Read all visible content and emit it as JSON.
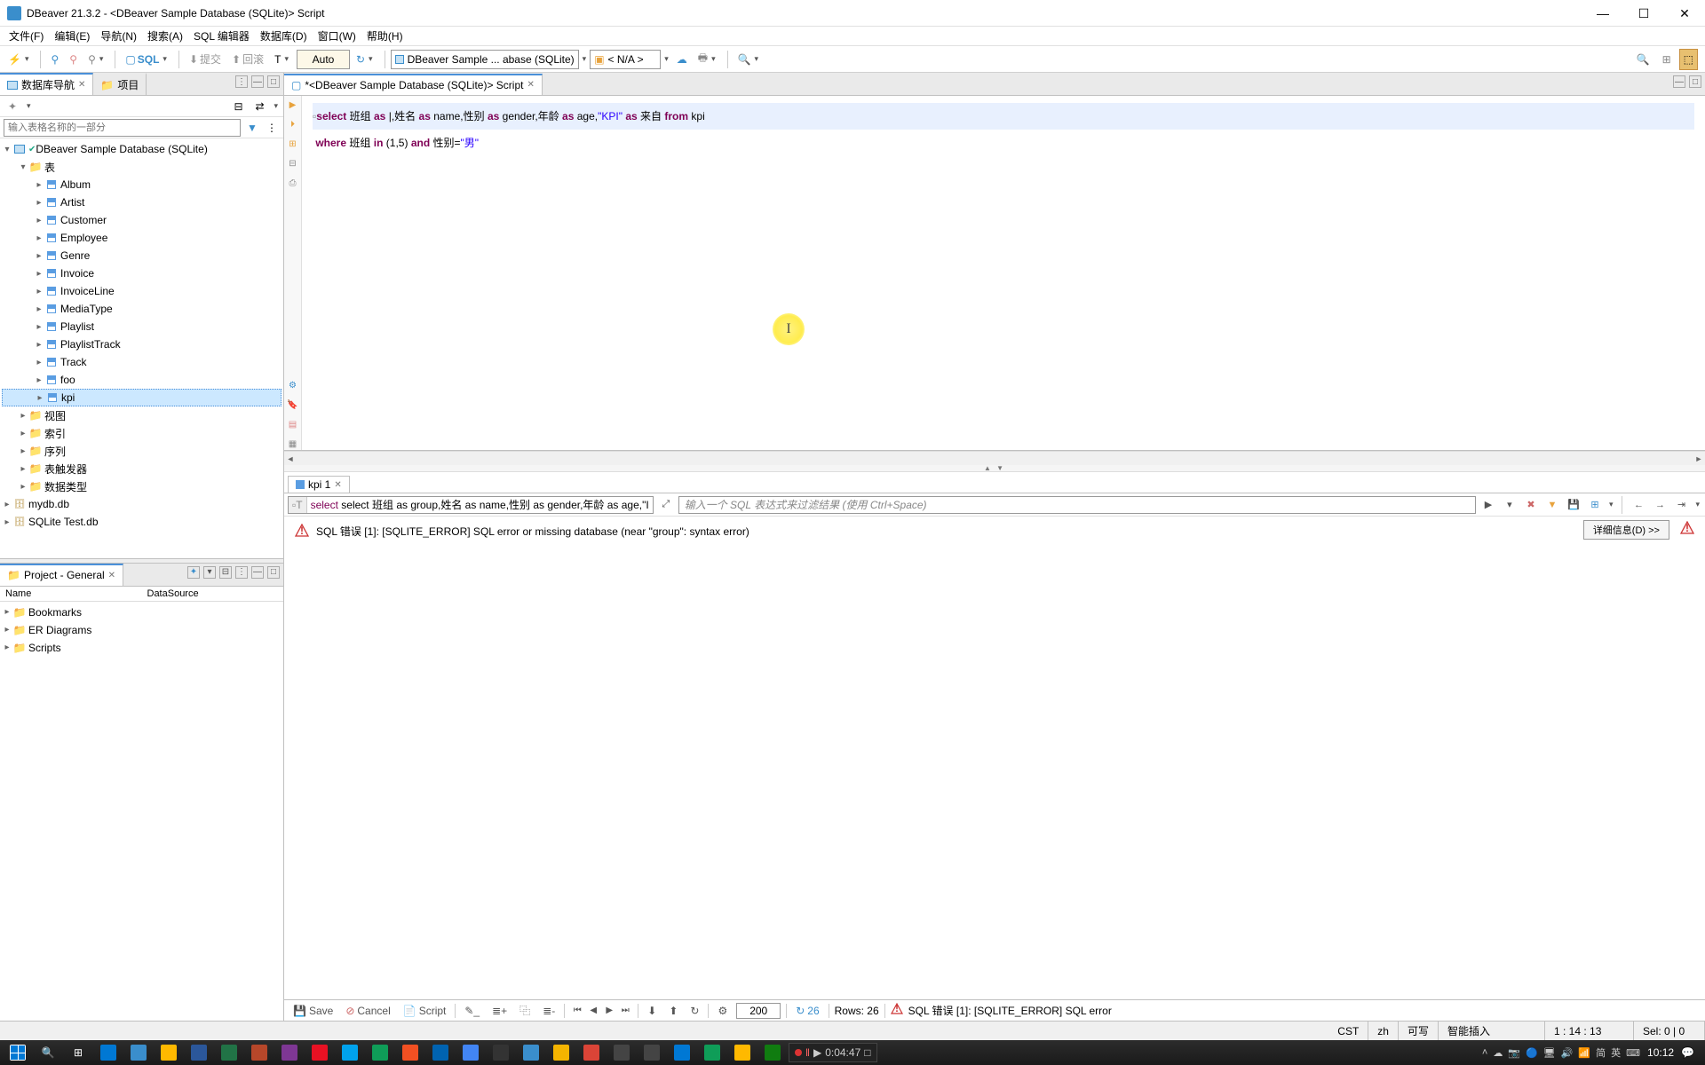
{
  "window": {
    "title": "DBeaver 21.3.2 - <DBeaver Sample Database (SQLite)> Script"
  },
  "menus": [
    "文件(F)",
    "编辑(E)",
    "导航(N)",
    "搜索(A)",
    "SQL 编辑器",
    "数据库(D)",
    "窗口(W)",
    "帮助(H)"
  ],
  "toolbar": {
    "sql_label": "SQL",
    "commit_label": "提交",
    "rollback_label": "回滚",
    "auto_label": "Auto",
    "conn1": "DBeaver Sample ... abase (SQLite)",
    "conn2": "< N/A >"
  },
  "nav": {
    "tab1": "数据库导航",
    "tab2": "项目",
    "filter_placeholder": "输入表格名称的一部分",
    "root": "DBeaver Sample Database (SQLite)",
    "tables_label": "表",
    "tables": [
      "Album",
      "Artist",
      "Customer",
      "Employee",
      "Genre",
      "Invoice",
      "InvoiceLine",
      "MediaType",
      "Playlist",
      "PlaylistTrack",
      "Track",
      "foo",
      "kpi"
    ],
    "folders": [
      "视图",
      "索引",
      "序列",
      "表触发器",
      "数据类型"
    ],
    "db1": "mydb.db",
    "db2": "SQLite Test.db"
  },
  "project": {
    "title": "Project - General",
    "col1": "Name",
    "col2": "DataSource",
    "items": [
      "Bookmarks",
      "ER Diagrams",
      "Scripts"
    ]
  },
  "editor": {
    "tab": "*<DBeaver Sample Database (SQLite)> Script",
    "sql_tokens": {
      "l1": {
        "select": "select",
        "f1": "班组",
        "as": "as",
        "cursor": "|",
        "f2": ",姓名",
        "name": "name",
        "f3": ",性别",
        "gender": "gender",
        "f4": ",年龄",
        "age": "age",
        "f5": ",",
        "kpi_str": "\"KPI\"",
        "from_field": "来自",
        "from": "from",
        "table": "kpi"
      },
      "l2": {
        "where": "where",
        "f1": "班组",
        "in": "in",
        "paren": "(",
        "n1": "1",
        "comma": ",",
        "n5": "5",
        "rparen": ")",
        "and": "and",
        "f2": "性别=",
        "str": "\"男\""
      }
    }
  },
  "results": {
    "tab": "kpi 1",
    "info_sql": "select 班组 as group,姓名 as name,性别 as gender,年龄 as age,\"I",
    "placeholder": "输入一个 SQL 表达式来过滤结果 (使用 Ctrl+Space)",
    "error": "SQL 错误 [1]: [SQLITE_ERROR] SQL error or missing database (near \"group\": syntax error)",
    "detail_btn": "详细信息(D) >>"
  },
  "bottom": {
    "save": "Save",
    "cancel": "Cancel",
    "script": "Script",
    "page_size": "200",
    "reload_count": "26",
    "rows": "Rows: 26",
    "error_short": "SQL 错误 [1]: [SQLITE_ERROR] SQL error"
  },
  "status": {
    "tz": "CST",
    "lang": "zh",
    "rw": "可写",
    "ins": "智能插入",
    "pos": "1 : 14 : 13",
    "sel": "Sel: 0 | 0"
  },
  "taskbar": {
    "rec_time": "0:04:47",
    "time": "10:12",
    "ime": "英",
    "ime2": "简"
  }
}
